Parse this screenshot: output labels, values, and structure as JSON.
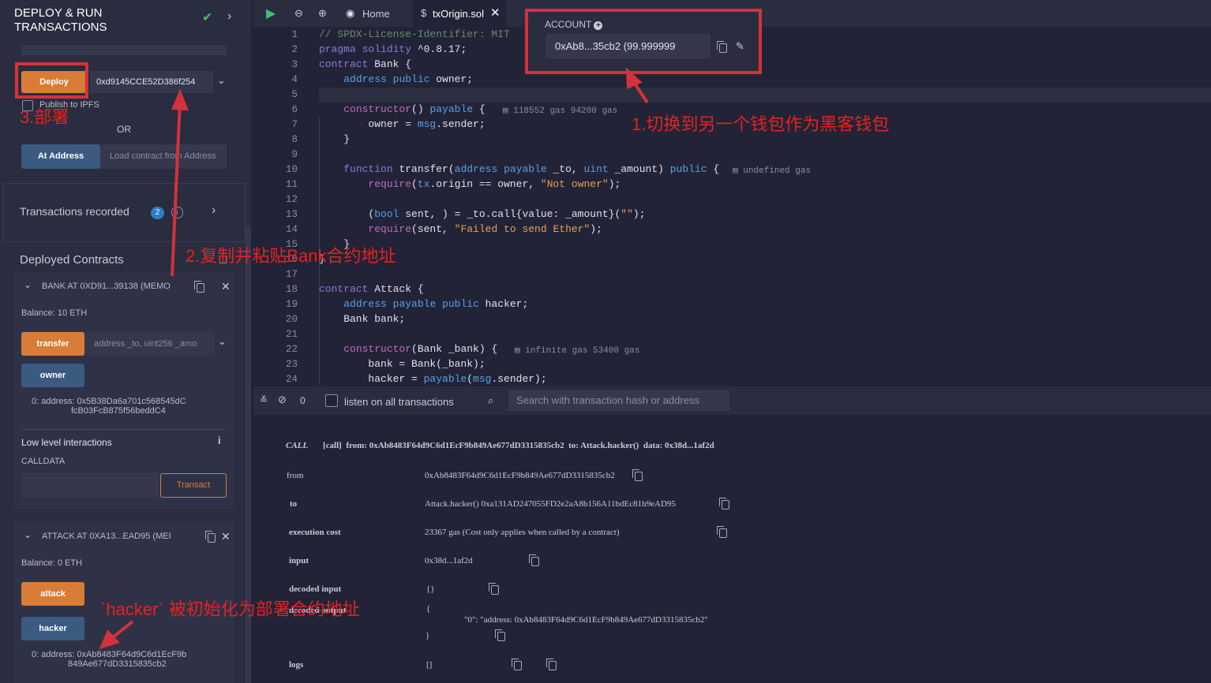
{
  "header": {
    "title_line1": "DEPLOY & RUN",
    "title_line2": "TRANSACTIONS"
  },
  "deploy": {
    "button": "Deploy",
    "address_value": "0xd9145CCE52D386f254",
    "publish_label": "Publish to IPFS",
    "or_label": "OR",
    "at_address_button": "At Address",
    "load_placeholder": "Load contract from Address"
  },
  "transactions_recorded": {
    "label": "Transactions recorded",
    "count": "2"
  },
  "deployed_contracts": {
    "title": "Deployed Contracts",
    "bank": {
      "title": "BANK AT 0XD91...39138 (MEMO",
      "balance": "Balance: 10 ETH",
      "transfer_button": "transfer",
      "transfer_placeholder": "address _to, uint256 _amo",
      "owner_button": "owner",
      "owner_result_line1": "0:  address: 0x5B38Da6a701c568545dC",
      "owner_result_line2": "fcB03FcB875f56beddC4",
      "low_level_title": "Low level interactions",
      "calldata_label": "CALLDATA",
      "transact_button": "Transact"
    },
    "attack": {
      "title": "ATTACK AT 0XA13...EAD95 (MEI",
      "balance": "Balance: 0 ETH",
      "attack_button": "attack",
      "hacker_button": "hacker",
      "hacker_result_line1": "0:  address: 0xAb8483F64d9C6d1EcF9b",
      "hacker_result_line2": "849Ae677dD3315835cb2"
    }
  },
  "tabs": {
    "home": "Home",
    "file": "txOrigin.sol"
  },
  "account": {
    "label": "ACCOUNT",
    "value": "0xAb8...35cb2 (99.999999"
  },
  "code": {
    "line_numbers": [
      "1",
      "2",
      "3",
      "4",
      "5",
      "6",
      "7",
      "8",
      "9",
      "10",
      "11",
      "12",
      "13",
      "14",
      "15",
      "16",
      "17",
      "18",
      "19",
      "20",
      "21",
      "22",
      "23",
      "24"
    ],
    "gas_constructor": "118552 gas 94200 gas",
    "gas_transfer": "undefined gas",
    "gas_attack_constructor": "infinite gas 53400 gas"
  },
  "terminal": {
    "count": "0",
    "listen_label": "listen on all transactions",
    "search_placeholder": "Search with transaction hash or address",
    "call_tag": "CALL",
    "call_line": "[call]  from: 0xAb8483F64d9C6d1EcF9b849Ae677dD3315835cb2  to: Attack.hacker()  data: 0x38d...1af2d",
    "rows": [
      {
        "label": "from",
        "value": "0xAb8483F64d9C6d1EcF9b849Ae677dD3315835cb2"
      },
      {
        "label": "to",
        "value": "Attack.hacker() 0xa131AD247055FD2e2aA8b156A11bdEc81b9eAD95"
      },
      {
        "label": "execution cost",
        "value": "23367 gas (Cost only applies when called by a contract)"
      },
      {
        "label": "input",
        "value": "0x38d...1af2d"
      },
      {
        "label": "decoded input",
        "value": "{}"
      },
      {
        "label": "decoded output",
        "value": "{"
      },
      {
        "label": "logs",
        "value": "[]"
      }
    ],
    "decoded_output_body": "\"0\": \"address: 0xAb8483F64d9C6d1EcF9b849Ae677dD3315835cb2\"",
    "decoded_output_close": "}"
  },
  "annotations": {
    "step1": "1.切换到另一个钱包作为黑客钱包",
    "step2": "2.复制并粘贴Bank合约地址",
    "step3": "3.部署",
    "hacker_note": "`hacker` 被初始化为部署合约地址"
  },
  "colors": {
    "accent_orange": "#d97c37",
    "accent_blue": "#3a5a80",
    "annotation_red": "#e52222"
  }
}
